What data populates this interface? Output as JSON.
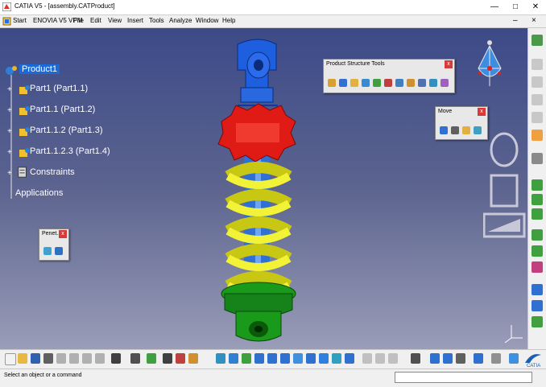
{
  "window": {
    "title": "CATIA V5 - [assembly.CATProduct]"
  },
  "menubar": {
    "items": [
      "Start",
      "ENOVIA V5 VPM",
      "File",
      "Edit",
      "View",
      "Insert",
      "Tools",
      "Analyze",
      "Window",
      "Help"
    ]
  },
  "tree": {
    "root": "Product1",
    "items": [
      "Part1 (Part1.1)",
      "Part1.1 (Part1.2)",
      "Part1.1.2 (Part1.3)",
      "Part1.1.2.3 (Part1.4)",
      "Constraints",
      "Applications"
    ]
  },
  "panels": {
    "product_structure": {
      "title": "Product Structure Tools",
      "close": "x"
    },
    "move": {
      "title": "Move",
      "close": "x"
    },
    "penetration": {
      "title": "Penet...",
      "close": "x"
    }
  },
  "status": {
    "text": "Select an object or a command",
    "command_value": ""
  },
  "brand": {
    "logo_text": "CATIA"
  },
  "colors": {
    "viewport_top": "#3c4a88",
    "viewport_bottom": "#9a9db8",
    "spring": "#ecec2a",
    "gear": "#e01a14",
    "clevis_top": "#1e5fe0",
    "base": "#1a9a1a",
    "tree_text": "#ffffff"
  }
}
